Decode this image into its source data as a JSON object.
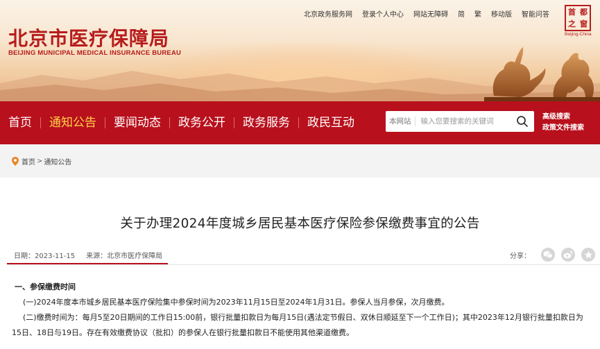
{
  "header": {
    "logo_cn": "北京市医疗保障局",
    "logo_en": "BEIJING MUNICIPAL MEDICAL INSURANCE BUREAU",
    "top_links": [
      "北京政务服务网",
      "登录个人中心",
      "网站无障碍",
      "简",
      "繁",
      "移动版",
      "智能问答"
    ],
    "seal_chars": [
      "首",
      "都",
      "之",
      "窗"
    ],
    "seal_en": "Beijing-China"
  },
  "nav": {
    "items": [
      {
        "label": "首页",
        "active": false
      },
      {
        "label": "通知公告",
        "active": true
      },
      {
        "label": "要闻动态",
        "active": false
      },
      {
        "label": "政务公开",
        "active": false
      },
      {
        "label": "政务服务",
        "active": false
      },
      {
        "label": "政民互动",
        "active": false
      }
    ],
    "search_scope": "本网站",
    "search_placeholder": "输入您要搜索的关键词",
    "advanced_search": "高级搜索",
    "doc_search": "政策文件搜索"
  },
  "breadcrumb": {
    "home": "首页",
    "separator": ">",
    "current": "通知公告"
  },
  "article": {
    "title": "关于办理2024年度城乡居民基本医疗保险参保缴费事宜的公告",
    "date_label": "日期：2023-11-15",
    "source_label": "来源：北京市医疗保障局",
    "share_label": "分享：",
    "paragraphs": [
      {
        "kind": "heading",
        "text": "一、参保缴费时间"
      },
      {
        "kind": "p",
        "text": "(一)2024年度本市城乡居民基本医疗保险集中参保时间为2023年11月15日至2024年1月31日。参保人当月参保，次月缴费。"
      },
      {
        "kind": "p",
        "text": "(二)缴费时间为：每月5至20日期间的工作日15:00前，银行批量扣款日为每月15日(遇法定节假日、双休日顺延至下一个工作日)；其中2023年12月银行批量扣款日为15日、18日与19日。存在有效缴费协议（批扣）的参保人在银行批量扣款日不能使用其他渠道缴费。"
      }
    ]
  },
  "colors": {
    "brand_red": "#b8101c",
    "nav_active": "#ffd24a",
    "logo_red": "#b71c1c"
  }
}
